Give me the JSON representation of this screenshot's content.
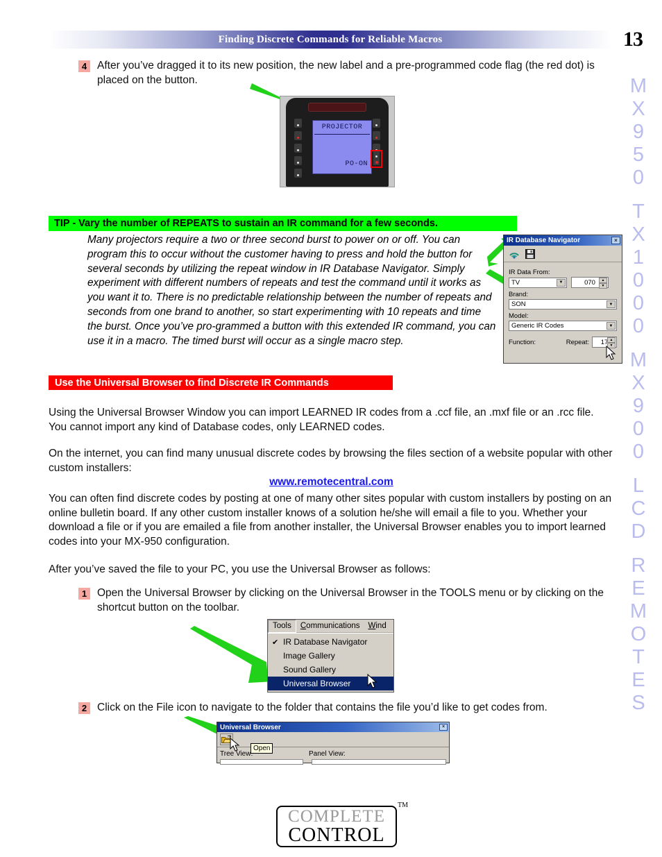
{
  "header": {
    "title": "Finding Discrete Commands for Reliable Macros",
    "page_number": "13"
  },
  "steps": {
    "step4": {
      "number": "4",
      "text": "After you’ve dragged it to its new position, the new label and a pre-programmed code flag (the red dot) is placed on the button."
    },
    "step1": {
      "number": "1",
      "text": "Open the Universal Browser by clicking on the Universal Browser in the TOOLS menu or by clicking on the shortcut button on the toolbar."
    },
    "step2": {
      "number": "2",
      "text": "Click on the File icon to navigate to the folder that contains the file you’d like to get codes from."
    }
  },
  "remote": {
    "lcd_title": "PROJECTOR",
    "lcd_label": "PO-ON"
  },
  "tip": {
    "banner": "TIP - Vary the number of REPEATS to sustain an IR command for a few seconds.",
    "body": "Many projectors require a two or three second burst to power on or off. You can program this to occur without the customer having to press and hold the button for several seconds by utilizing the repeat window in IR Database Navigator. Simply experiment with different numbers of repeats and test the command until it works as you want it to. There is no predictable relationship between the number of repeats and seconds from one brand to another, so start experimenting with 10 repeats and time the burst. Once you’ve pro-grammed a button with this extended IR command, you can use it in a macro. The timed burst will occur as a single macro step."
  },
  "ir_dialog": {
    "title": "IR Database Navigator",
    "close_label": "×",
    "data_from_label": "IR Data From:",
    "data_from_value": "TV",
    "code_value": "070",
    "brand_label": "Brand:",
    "brand_value": "SON",
    "model_label": "Model:",
    "model_value": "Generic IR Codes",
    "function_label": "Function:",
    "repeat_label": "Repeat:",
    "repeat_value": "17"
  },
  "section": {
    "red_banner": "Use the Universal Browser to find Discrete IR Commands",
    "para1": "Using the Universal Browser Window you can import LEARNED IR codes from a .ccf file, an .mxf file or an .rcc file.  You cannot import any kind of Database codes, only LEARNED codes.",
    "para2": "On the internet, you can find many unusual discrete codes by browsing the files section of a website popular with other custom installers:",
    "link": "www.remotecentral.com",
    "para3": "You can often find discrete codes by posting at one of many other sites popular with custom installers by posting on an online bulletin board. If any other custom installer knows of a solution he/she will email a file to you.  Whether your download a file or if you are emailed a file from another installer, the Universal Browser enables you to import learned codes into your MX-950 configuration.",
    "para4": "After you’ve saved the file to your PC, you use the Universal Browser as follows:"
  },
  "tools_menu": {
    "menubar": [
      {
        "label": "Tools",
        "underline": ""
      },
      {
        "label": "Communications",
        "underline": "C"
      },
      {
        "label": "Wind",
        "underline": "W"
      }
    ],
    "items": [
      {
        "label": "IR Database Navigator",
        "checked": true,
        "selected": false
      },
      {
        "label": "Image Gallery",
        "checked": false,
        "selected": false
      },
      {
        "label": "Sound Gallery",
        "checked": false,
        "selected": false
      },
      {
        "label": "Universal Browser",
        "checked": false,
        "selected": true
      }
    ]
  },
  "universal_browser": {
    "title": "Universal Browser",
    "close_label": "×",
    "tooltip": "Open",
    "tree_view_label": "Tree View:",
    "panel_view_label": "Panel View:"
  },
  "side_strip": {
    "lines": [
      "MX950",
      "TX1000",
      "MX900",
      "LCD",
      "REMOTES"
    ]
  },
  "logo": {
    "line1": "COMPLETE",
    "line2": "CONTROL",
    "tm": "TM"
  },
  "colors": {
    "tip_green": "#00ff00",
    "red_banner": "#fc0000",
    "step_badge": "#f5a8a0",
    "link_blue": "#1a1aee",
    "arrow_green": "#22d11a",
    "side_strip": "#b9bcec",
    "header_blue": "#2e2f8f"
  }
}
